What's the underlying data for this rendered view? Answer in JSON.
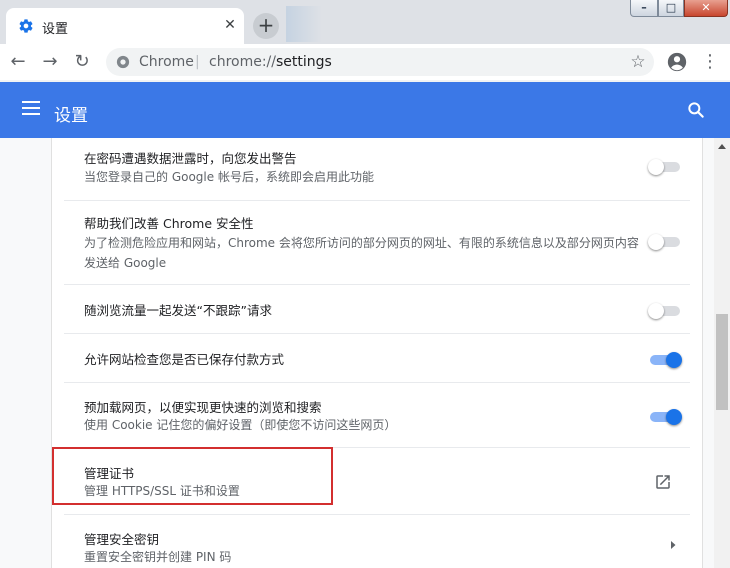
{
  "tab": {
    "title": "设置",
    "close": "✕",
    "favicon": "gear-icon"
  },
  "newtab": {
    "label": "+"
  },
  "window": {
    "minimize": "–",
    "maximize": "□",
    "close": "✕"
  },
  "toolbar": {
    "back": "←",
    "forward": "→",
    "reload": "↻",
    "omnibox_site": "Chrome",
    "omnibox_sep": "|",
    "omnibox_scheme": "chrome://",
    "omnibox_host": "settings",
    "star": "☆",
    "profile": "account-circle-icon",
    "menu": "⋮"
  },
  "header": {
    "title": "设置",
    "menu_icon": "hamburger-menu-icon",
    "search_icon": "search-icon",
    "color": "#3b78e7"
  },
  "settings": [
    {
      "title": "在密码遭遇数据泄露时，向您发出警告",
      "subtitle": "当您登录自己的 Google 帐号后，系统即会启用此功能",
      "control": "toggle",
      "on": false
    },
    {
      "title": "帮助我们改善 Chrome 安全性",
      "subtitle": "为了检测危险应用和网站，Chrome 会将您所访问的部分网页的网址、有限的系统信息以及部分网页内容发送给 Google",
      "control": "toggle",
      "on": false
    },
    {
      "title": "随浏览流量一起发送“不跟踪”请求",
      "subtitle": "",
      "control": "toggle",
      "on": false
    },
    {
      "title": "允许网站检查您是否已保存付款方式",
      "subtitle": "",
      "control": "toggle",
      "on": true
    },
    {
      "title": "预加载网页，以便实现更快速的浏览和搜索",
      "subtitle": "使用 Cookie 记住您的偏好设置（即使您不访问这些网页）",
      "control": "toggle",
      "on": true
    },
    {
      "title": "管理证书",
      "subtitle": "管理 HTTPS/SSL 证书和设置",
      "control": "external-link",
      "icon": "open-in-new-icon"
    },
    {
      "title": "管理安全密钥",
      "subtitle": "重置安全密钥并创建 PIN 码",
      "control": "arrow",
      "icon": "chevron-right-icon"
    }
  ],
  "colors": {
    "accent": "#1a73e8",
    "highlight_border": "#d32f2f"
  }
}
